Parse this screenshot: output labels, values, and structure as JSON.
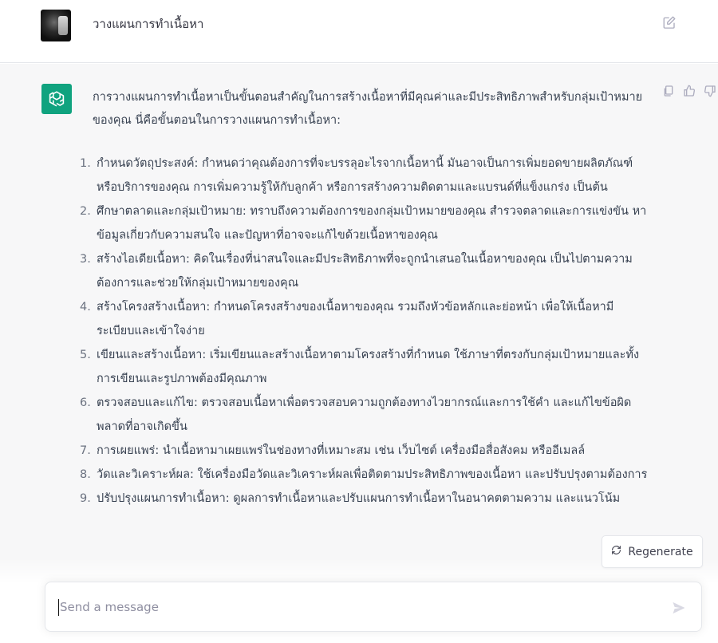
{
  "user_message": {
    "text": "วางแผนการทำเนื้อหา"
  },
  "assistant_message": {
    "intro": "การวางแผนการทำเนื้อหาเป็นขั้นตอนสำคัญในการสร้างเนื้อหาที่มีคุณค่าและมีประสิทธิภาพสำหรับกลุ่มเป้าหมายของคุณ นี่คือขั้นตอนในการวางแผนการทำเนื้อหา:",
    "steps": [
      {
        "num": "1.",
        "text": "กำหนดวัตถุประสงค์: กำหนดว่าคุณต้องการที่จะบรรลุอะไรจากเนื้อหานี้ มันอาจเป็นการเพิ่มยอดขายผลิตภัณฑ์หรือบริการของคุณ การเพิ่มความรู้ให้กับลูกค้า หรือการสร้างความติดตามและแบรนด์ที่แข็งแกร่ง เป็นต้น"
      },
      {
        "num": "2.",
        "text": "ศึกษาตลาดและกลุ่มเป้าหมาย: ทราบถึงความต้องการของกลุ่มเป้าหมายของคุณ สำรวจตลาดและการแข่งขัน หาข้อมูลเกี่ยวกับความสนใจ และปัญหาที่อาจจะแก้ไขด้วยเนื้อหาของคุณ"
      },
      {
        "num": "3.",
        "text": "สร้างไอเดียเนื้อหา: คิดในเรื่องที่น่าสนใจและมีประสิทธิภาพที่จะถูกนำเสนอในเนื้อหาของคุณ เป็นไปตามความต้องการและช่วยให้กลุ่มเป้าหมายของคุณ"
      },
      {
        "num": "4.",
        "text": "สร้างโครงสร้างเนื้อหา: กำหนดโครงสร้างของเนื้อหาของคุณ รวมถึงหัวข้อหลักและย่อหน้า เพื่อให้เนื้อหามีระเบียบและเข้าใจง่าย"
      },
      {
        "num": "5.",
        "text": "เขียนและสร้างเนื้อหา: เริ่มเขียนและสร้างเนื้อหาตามโครงสร้างที่กำหนด ใช้ภาษาที่ตรงกับกลุ่มเป้าหมายและทั้งการเขียนและรูปภาพต้องมีคุณภาพ"
      },
      {
        "num": "6.",
        "text": "ตรวจสอบและแก้ไข: ตรวจสอบเนื้อหาเพื่อตรวจสอบความถูกต้องทางไวยากรณ์และการใช้คำ และแก้ไขข้อผิดพลาดที่อาจเกิดขึ้น"
      },
      {
        "num": "7.",
        "text": "การเผยแพร่: นำเนื้อหามาเผยแพร่ในช่องทางที่เหมาะสม เช่น เว็บไซต์ เครื่องมือสื่อสังคม หรืออีเมลล์"
      },
      {
        "num": "8.",
        "text": "วัดและวิเคราะห์ผล: ใช้เครื่องมือวัดและวิเคราะห์ผลเพื่อติดตามประสิทธิภาพของเนื้อหา และปรับปรุงตามต้องการ"
      },
      {
        "num": "9.",
        "text": "ปรับปรุงแผนการทำเนื้อหา: ดูผลการทำเนื้อหาและปรับแผนการทำเนื้อหาในอนาคตตามความ และแนวโน้ม"
      }
    ]
  },
  "regenerate": {
    "label": "Regenerate"
  },
  "composer": {
    "placeholder": "Send a message"
  },
  "colors": {
    "brand": "#10a37f",
    "assistant_bg": "#f7f7f8",
    "text": "#374151"
  },
  "icons": [
    "edit-icon",
    "openai-logo-icon",
    "copy-icon",
    "thumbs-up-icon",
    "thumbs-down-icon",
    "refresh-icon",
    "send-icon"
  ]
}
